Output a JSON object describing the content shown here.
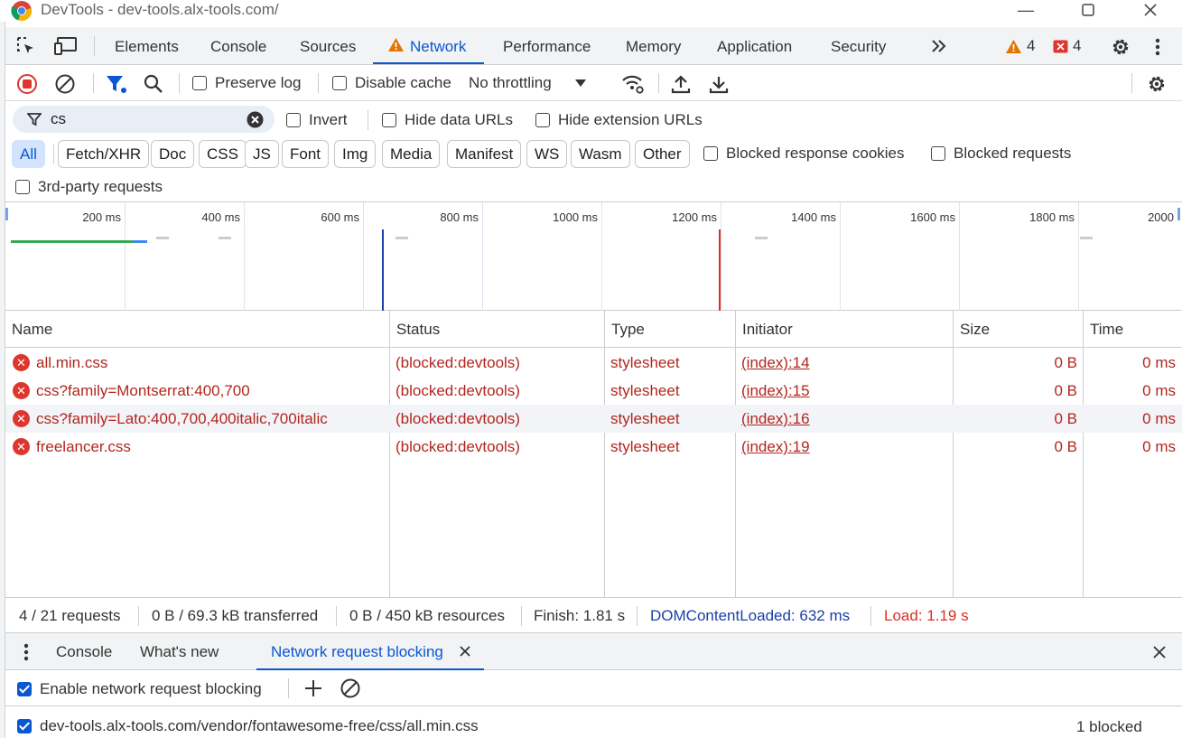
{
  "window": {
    "title": "DevTools - dev-tools.alx-tools.com/"
  },
  "main_tabs": [
    {
      "label": "Elements"
    },
    {
      "label": "Console"
    },
    {
      "label": "Sources"
    },
    {
      "label": "Network"
    },
    {
      "label": "Performance"
    },
    {
      "label": "Memory"
    },
    {
      "label": "Application"
    },
    {
      "label": "Security"
    }
  ],
  "badges": {
    "warnings": "4",
    "errors": "4"
  },
  "toolbar": {
    "preserve_log": "Preserve log",
    "disable_cache": "Disable cache",
    "throttling": "No throttling"
  },
  "filter": {
    "value": "cs",
    "invert": "Invert",
    "hide_data_urls": "Hide data URLs",
    "hide_extension_urls": "Hide extension URLs"
  },
  "type_filters": [
    "All",
    "Fetch/XHR",
    "Doc",
    "CSS",
    "JS",
    "Font",
    "Img",
    "Media",
    "Manifest",
    "WS",
    "Wasm",
    "Other"
  ],
  "type_row_checks": {
    "blocked_cookies": "Blocked response cookies",
    "blocked_requests": "Blocked requests"
  },
  "third_party": "3rd-party requests",
  "timeline": {
    "ticks": [
      "200 ms",
      "400 ms",
      "600 ms",
      "800 ms",
      "1000 ms",
      "1200 ms",
      "1400 ms",
      "1600 ms",
      "1800 ms",
      "2000"
    ]
  },
  "table": {
    "headers": [
      "Name",
      "Status",
      "Type",
      "Initiator",
      "Size",
      "Time"
    ],
    "rows": [
      {
        "name": "all.min.css",
        "status": "(blocked:devtools)",
        "type": "stylesheet",
        "initiator": "(index):14",
        "size": "0 B",
        "time": "0 ms"
      },
      {
        "name": "css?family=Montserrat:400,700",
        "status": "(blocked:devtools)",
        "type": "stylesheet",
        "initiator": "(index):15",
        "size": "0 B",
        "time": "0 ms"
      },
      {
        "name": "css?family=Lato:400,700,400italic,700italic",
        "status": "(blocked:devtools)",
        "type": "stylesheet",
        "initiator": "(index):16",
        "size": "0 B",
        "time": "0 ms"
      },
      {
        "name": "freelancer.css",
        "status": "(blocked:devtools)",
        "type": "stylesheet",
        "initiator": "(index):19",
        "size": "0 B",
        "time": "0 ms"
      }
    ]
  },
  "status_bar": {
    "requests": "4 / 21 requests",
    "transferred": "0 B / 69.3 kB transferred",
    "resources": "0 B / 450 kB resources",
    "finish": "Finish: 1.81 s",
    "dom_loaded": "DOMContentLoaded: 632 ms",
    "load": "Load: 1.19 s"
  },
  "drawer": {
    "tabs": [
      "Console",
      "What's new",
      "Network request blocking"
    ],
    "enable_blocking": "Enable network request blocking",
    "pattern": "dev-tools.alx-tools.com/vendor/fontawesome-free/css/all.min.css",
    "pattern_count": "1 blocked"
  },
  "colors": {
    "accent": "#0b57d0",
    "error": "#b3261e",
    "dom_line": "#1a3fa8",
    "load_line": "#d93025"
  }
}
